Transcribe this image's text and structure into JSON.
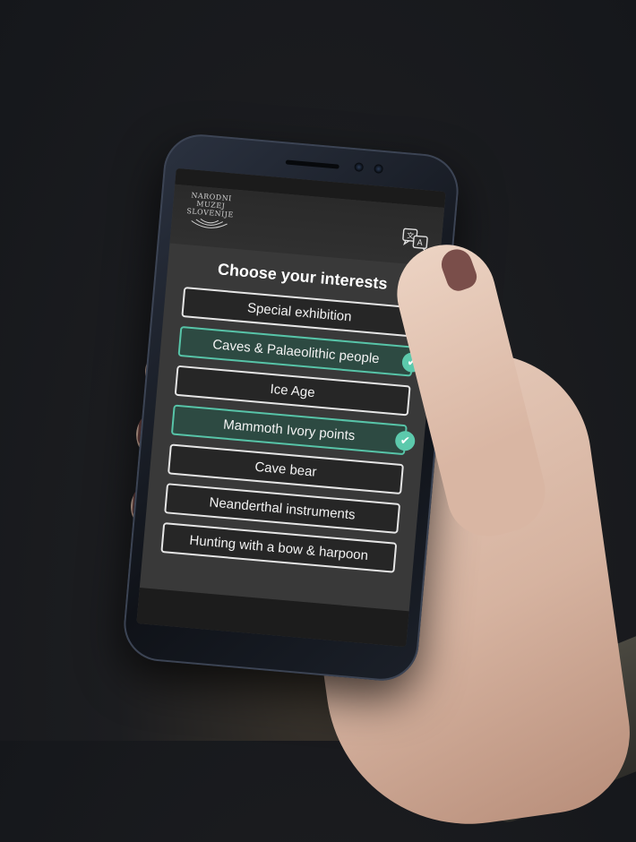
{
  "museum_logo": {
    "line1": "NARODNI",
    "line2": "MUZEJ",
    "line3": "SLOVENIJE"
  },
  "translate_icon": "translate-icon",
  "title": "Choose your interests",
  "options": [
    {
      "label": "Special exhibition",
      "selected": false
    },
    {
      "label": "Caves & Palaeolithic people",
      "selected": true
    },
    {
      "label": "Ice Age",
      "selected": false
    },
    {
      "label": "Mammoth Ivory points",
      "selected": true
    },
    {
      "label": "Cave bear",
      "selected": false
    },
    {
      "label": "Neanderthal instruments",
      "selected": false
    },
    {
      "label": "Hunting with a bow & harpoon",
      "selected": false
    }
  ],
  "colors": {
    "accent": "#5cc9ac",
    "selected_background": "#2d4a42",
    "screen_background": "#393939"
  }
}
